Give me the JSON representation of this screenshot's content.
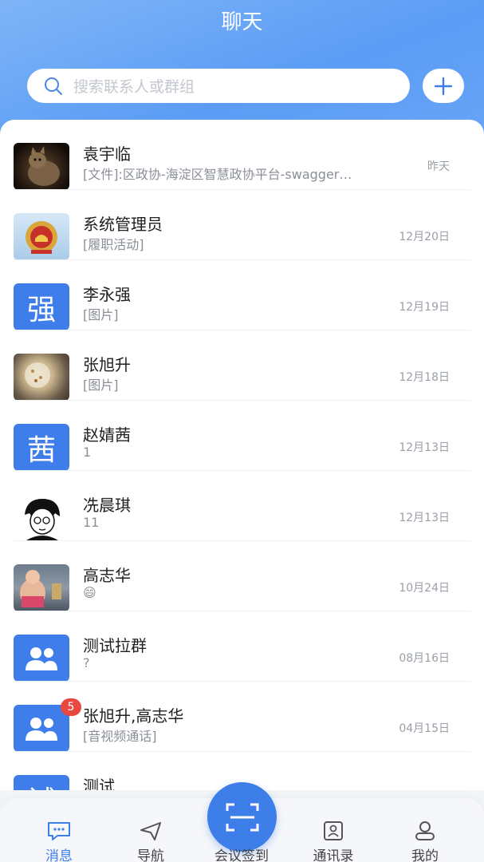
{
  "header": {
    "title": "聊天"
  },
  "search": {
    "placeholder": "搜索联系人或群组"
  },
  "colors": {
    "accent": "#3e7ee8",
    "badge": "#e8483f",
    "avatar_blue": "#3f7eea"
  },
  "chats": [
    {
      "name": "袁宇临",
      "message": "[文件]:区政协-海淀区智慧政协平台-swagger…",
      "time": "昨天",
      "avatar": "photo-cat"
    },
    {
      "name": "系统管理员",
      "message": "[履职活动]",
      "time": "12月20日",
      "avatar": "emblem-image"
    },
    {
      "name": "李永强",
      "message": "[图片]",
      "time": "12月19日",
      "avatar_text": "强"
    },
    {
      "name": "张旭升",
      "message": "[图片]",
      "time": "12月18日",
      "avatar": "photo-food"
    },
    {
      "name": "赵婧茜",
      "message": "1",
      "time": "12月13日",
      "avatar_text": "茜"
    },
    {
      "name": "冼晨琪",
      "message": "11",
      "time": "12月13日",
      "avatar": "cartoon-avatar"
    },
    {
      "name": "高志华",
      "message": "😄",
      "time": "10月24日",
      "avatar": "photo-person"
    },
    {
      "name": "测试拉群",
      "message": "?",
      "time": "08月16日",
      "avatar": "group-icon"
    },
    {
      "name": "张旭升,高志华",
      "message": "[音视频通话]",
      "time": "04月15日",
      "avatar": "group-icon",
      "unread": "5"
    },
    {
      "name": "测试",
      "message": "",
      "time": "",
      "avatar_text": "试"
    }
  ],
  "tabs": [
    {
      "label": "消息",
      "icon": "message-icon",
      "active": true
    },
    {
      "label": "导航",
      "icon": "navigation-icon"
    },
    {
      "label": "会议签到",
      "icon": "scan-icon"
    },
    {
      "label": "通讯录",
      "icon": "contacts-icon"
    },
    {
      "label": "我的",
      "icon": "profile-icon"
    }
  ]
}
